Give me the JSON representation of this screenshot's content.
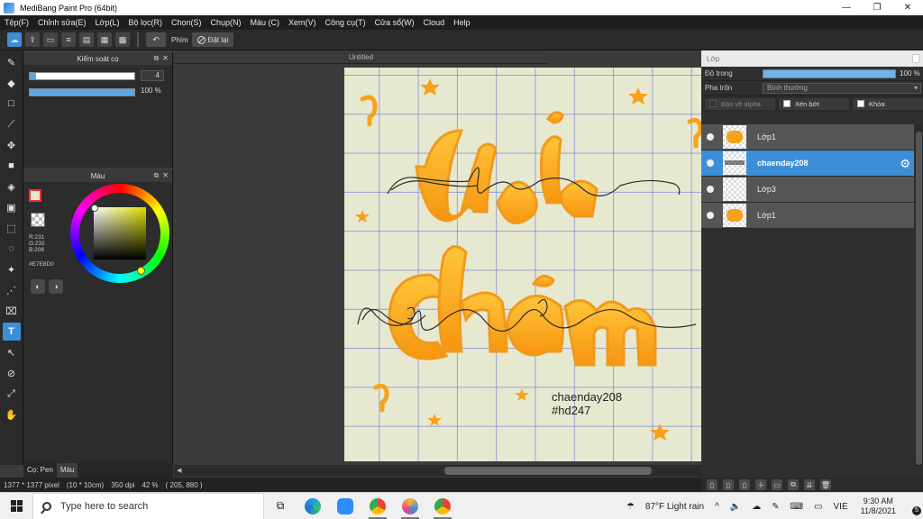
{
  "window": {
    "title": "MediBang Paint Pro (64bit)",
    "minimize": "—",
    "maximize": "❐",
    "close": "✕"
  },
  "menu": [
    "Tệp(F)",
    "Chỉnh sửa(E)",
    "Lớp(L)",
    "Bộ lọc(R)",
    "Chọn(S)",
    "Chụp(N)",
    "Màu (C)",
    "Xem(V)",
    "Công cụ(T)",
    "Cửa sổ(W)",
    "Cloud",
    "Help"
  ],
  "toolbar": {
    "label": "Phím",
    "reset_label": "Đặt lại"
  },
  "brush_panel": {
    "title": "Kiểm soát cọ",
    "size_value": "4",
    "opacity_value": "100 %",
    "size_fraction": 0.98,
    "opacity_fraction": 1.0
  },
  "color_panel": {
    "title": "Màu",
    "r": "R:231",
    "g": "G:232",
    "b": "B:208",
    "hex": "#E7E8D0",
    "current_color": "#E7E8D0"
  },
  "bottom_tabs": {
    "pen": "Cọ: Pen",
    "color": "Màu"
  },
  "document": {
    "tab_title": "Untitled",
    "watermark_line1": "chaenday208",
    "watermark_line2": "#hd247",
    "bg_color": "#E7E8D0"
  },
  "layers_panel": {
    "title": "Lớp",
    "opacity_label": "Độ trong",
    "opacity_value": "100 %",
    "blend_label": "Pha trộn",
    "blend_value": "Bình thường",
    "protect_alpha": "Bảo vệ alpha",
    "clipping": "Xén bớt",
    "lock": "Khóa",
    "layers": [
      {
        "name": "Lớp1",
        "active": false
      },
      {
        "name": "chaenday208",
        "active": true
      },
      {
        "name": "Lớp3",
        "active": false
      },
      {
        "name": "Lớp1",
        "active": false
      }
    ]
  },
  "status": {
    "size": "1377 * 1377 pixel",
    "cm": "(10 * 10cm)",
    "dpi": "350 dpi",
    "zoom": "42 %",
    "coords": "( 205, 880 )"
  },
  "taskbar": {
    "search_placeholder": "Type here to search",
    "weather": "87°F  Light rain",
    "lang": "VIE",
    "time": "9:30 AM",
    "date": "11/8/2021",
    "notifications": "5"
  },
  "accent_color": "#3C8FD6"
}
